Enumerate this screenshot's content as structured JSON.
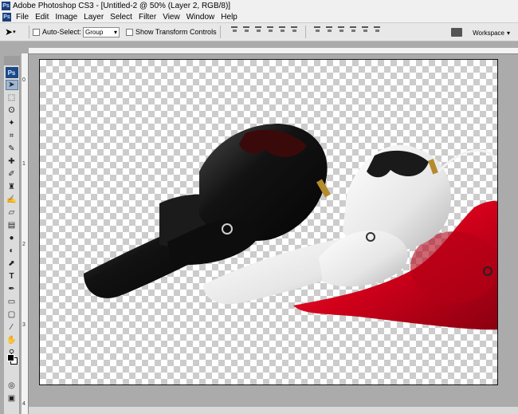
{
  "app": {
    "title": "Adobe Photoshop CS3 - [Untitled-2 @ 50% (Layer 2, RGB/8)]",
    "logo_text": "Ps"
  },
  "menu": {
    "items": [
      "File",
      "Edit",
      "Image",
      "Layer",
      "Select",
      "Filter",
      "View",
      "Window",
      "Help"
    ]
  },
  "options": {
    "auto_select_label": "Auto-Select:",
    "auto_select_value": "Group",
    "show_transform_label": "Show Transform Controls",
    "workspace_label": "Workspace"
  },
  "ruler": {
    "left_numbers": [
      "0",
      "1",
      "2",
      "3",
      "4"
    ]
  },
  "tools": [
    "move-tool",
    "marquee-tool",
    "lasso-tool",
    "magic-wand-tool",
    "crop-tool",
    "slice-tool",
    "healing-brush-tool",
    "brush-tool",
    "clone-stamp-tool",
    "history-brush-tool",
    "eraser-tool",
    "gradient-tool",
    "blur-tool",
    "dodge-tool",
    "path-selection-tool",
    "type-tool",
    "pen-tool",
    "shape-tool",
    "notes-tool",
    "eyedropper-tool",
    "hand-tool",
    "zoom-tool"
  ],
  "colors": {
    "canvas_checker": "#cccccc",
    "headphone_black": "#141414",
    "headphone_white": "#e9e9e9",
    "headphone_red": "#d4001a"
  }
}
